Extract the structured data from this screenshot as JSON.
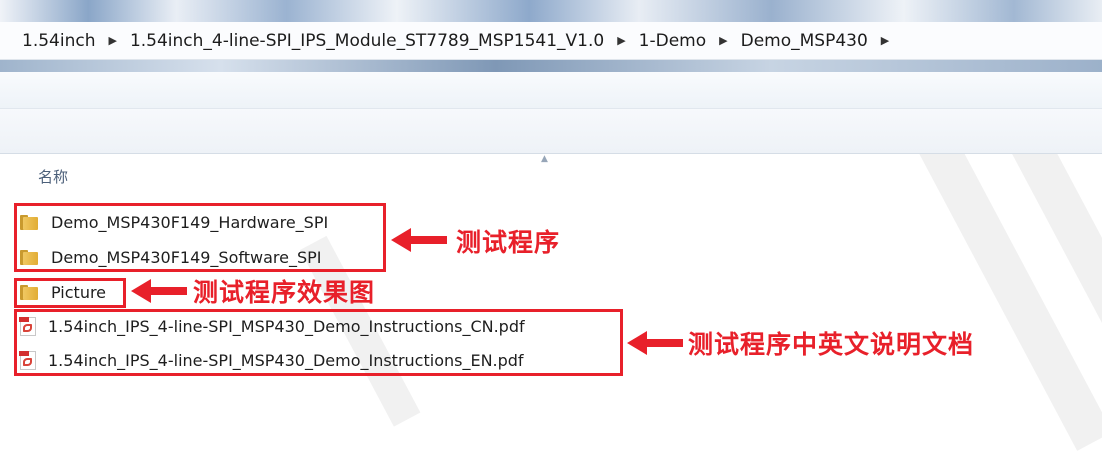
{
  "breadcrumb": [
    "1.54inch",
    "1.54inch_4-line-SPI_IPS_Module_ST7789_MSP1541_V1.0",
    "1-Demo",
    "Demo_MSP430"
  ],
  "column_header": {
    "name": "名称"
  },
  "files": [
    {
      "name": "Demo_MSP430F149_Hardware_SPI",
      "type": "folder",
      "icon": "folder-icon"
    },
    {
      "name": "Demo_MSP430F149_Software_SPI",
      "type": "folder",
      "icon": "folder-icon"
    },
    {
      "name": "Picture",
      "type": "folder",
      "icon": "folder-icon"
    },
    {
      "name": "1.54inch_IPS_4-line-SPI_MSP430_Demo_Instructions_CN.pdf",
      "type": "pdf",
      "icon": "pdf-icon"
    },
    {
      "name": "1.54inch_IPS_4-line-SPI_MSP430_Demo_Instructions_EN.pdf",
      "type": "pdf",
      "icon": "pdf-icon"
    }
  ],
  "annotations": {
    "test_program": "测试程序",
    "test_program_effect": "测试程序效果图",
    "test_program_docs": "测试程序中英文说明文档"
  },
  "colors": {
    "annotation": "#e8202a",
    "header_text": "#4c607a"
  }
}
